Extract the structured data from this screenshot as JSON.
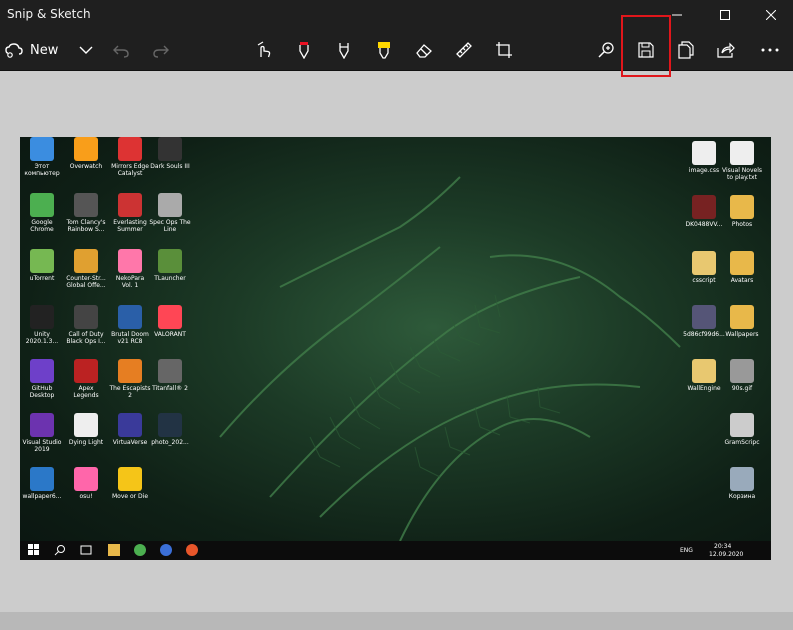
{
  "window": {
    "title": "Snip & Sketch"
  },
  "toolbar": {
    "new_label": "New",
    "tools": [
      "touch-writing",
      "ballpoint-pen",
      "pencil",
      "highlighter",
      "eraser",
      "ruler",
      "crop"
    ],
    "actions": [
      "zoom",
      "save",
      "copy",
      "share",
      "more"
    ]
  },
  "colors": {
    "accent": "#4a90e2",
    "highlight_box": "#e0161b",
    "pen_tip": "#e81123",
    "highlighter": "#ffd800"
  },
  "snip": {
    "desktop_icons": [
      {
        "label": "Этот\nкомпьютер",
        "color": "#3b8de0"
      },
      {
        "label": "Overwatch",
        "color": "#f99e1a"
      },
      {
        "label": "Mirrors Edge\nCatalyst",
        "color": "#d33"
      },
      {
        "label": "Dark Souls III",
        "color": "#333"
      },
      {
        "label": "Google\nChrome",
        "color": "#4caf50"
      },
      {
        "label": "Tom Clancy's\nRainbow S...",
        "color": "#555"
      },
      {
        "label": "Everlasting\nSummer",
        "color": "#c33"
      },
      {
        "label": "Spec Ops The\nLine",
        "color": "#aaa"
      },
      {
        "label": "uTorrent",
        "color": "#76b852"
      },
      {
        "label": "Counter-Str...\nGlobal Offe...",
        "color": "#e0a030"
      },
      {
        "label": "NekoPara\nVol. 1",
        "color": "#f7a"
      },
      {
        "label": "TLauncher",
        "color": "#5a8f3a"
      },
      {
        "label": "Unity\n2020.1.3...",
        "color": "#222"
      },
      {
        "label": "Call of Duty\nBlack Ops I...",
        "color": "#444"
      },
      {
        "label": "Brutal Doom\nv21 RC8",
        "color": "#2a5fa8"
      },
      {
        "label": "VALORANT",
        "color": "#ff4655"
      },
      {
        "label": "GitHub\nDesktop",
        "color": "#6e40c9"
      },
      {
        "label": "Apex\nLegends",
        "color": "#b22"
      },
      {
        "label": "The Escapists\n2",
        "color": "#e67e22"
      },
      {
        "label": "Titanfall® 2",
        "color": "#666"
      },
      {
        "label": "Visual Studio\n2019",
        "color": "#6c33af"
      },
      {
        "label": "Dying Light",
        "color": "#eee"
      },
      {
        "label": "VirtuaVerse",
        "color": "#3a3a9a"
      },
      {
        "label": "photo_202...",
        "color": "#234"
      },
      {
        "label": "wallpaper6...",
        "color": "#2b78c8"
      },
      {
        "label": "osu!",
        "color": "#ff66aa"
      },
      {
        "label": "Move or Die",
        "color": "#f5c518"
      },
      {
        "label": "image.css",
        "color": "#eee"
      },
      {
        "label": "Visual Novels\nto play.txt",
        "color": "#eee"
      },
      {
        "label": "DK0488VV...",
        "color": "#722"
      },
      {
        "label": "Photos",
        "color": "#e8b84a"
      },
      {
        "label": "csscript",
        "color": "#e8c870"
      },
      {
        "label": "Avatars",
        "color": "#e8b84a"
      },
      {
        "label": "5d86cf99d6...",
        "color": "#557"
      },
      {
        "label": "Wallpapers",
        "color": "#e8b84a"
      },
      {
        "label": "WallEngine",
        "color": "#e8c870"
      },
      {
        "label": "90s.gif",
        "color": "#999"
      },
      {
        "label": "GramScripc",
        "color": "#ccc"
      },
      {
        "label": "Корзина",
        "color": "#9ab"
      }
    ],
    "taskbar": {
      "lang": "ENG",
      "time": "20:34",
      "date": "12.09.2020"
    }
  }
}
